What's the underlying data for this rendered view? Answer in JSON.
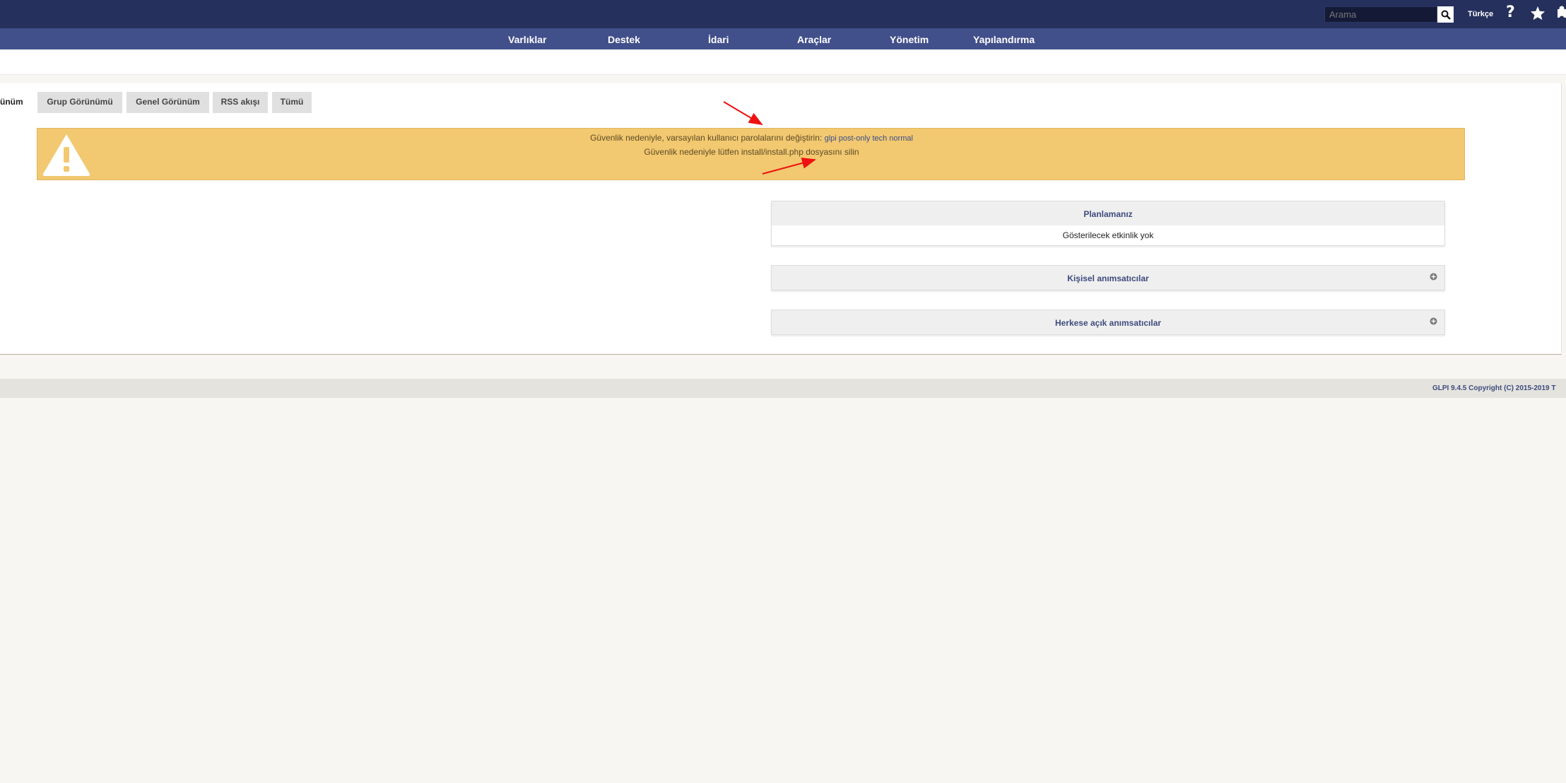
{
  "header": {
    "search_placeholder": "Arama",
    "language": "Türkçe",
    "help_symbol": "?"
  },
  "menu": {
    "items": [
      "Varlıklar",
      "Destek",
      "İdari",
      "Araçlar",
      "Yönetim",
      "Yapılandırma"
    ]
  },
  "tabs": {
    "active_partial": "ünüm",
    "items": [
      "Grup Görünümü",
      "Genel Görünüm",
      "RSS akışı",
      "Tümü"
    ]
  },
  "warning": {
    "line1_prefix": "Güvenlik nedeniyle, varsayılan kullanıcı parolalarını değiştirin: ",
    "line1_links": "glpi post-only tech normal",
    "line2": "Güvenlik nedeniyle lütfen install/install.php dosyasını silin"
  },
  "panels": {
    "planning": {
      "title": "Planlamanız",
      "empty_text": "Gösterilecek etkinlik yok"
    },
    "personal_reminders": {
      "title": "Kişisel anımsatıcılar"
    },
    "public_reminders": {
      "title": "Herkese açık anımsatıcılar"
    }
  },
  "footer": {
    "copyright": "GLPI 9.4.5 Copyright (C) 2015-2019 T"
  },
  "colors": {
    "topbar": "#25305d",
    "menubar": "#414f8b",
    "warning_bg": "#f2c870",
    "annotation_arrow": "#ee1111"
  }
}
